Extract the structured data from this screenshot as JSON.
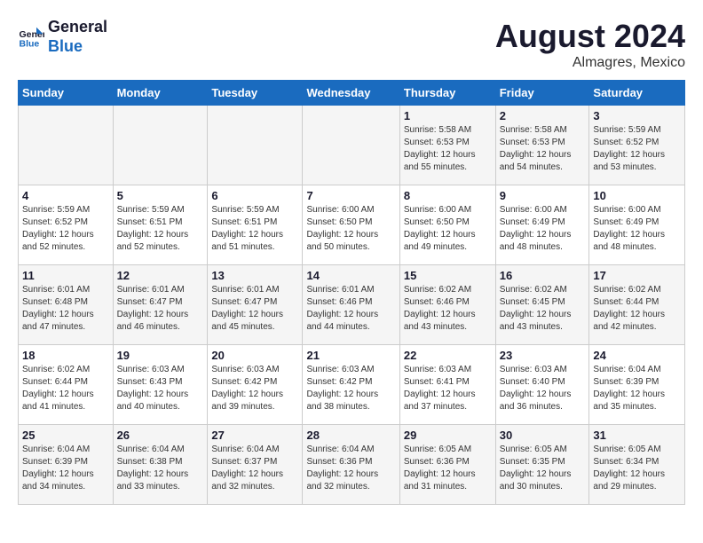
{
  "header": {
    "logo_line1": "General",
    "logo_line2": "Blue",
    "month_year": "August 2024",
    "location": "Almagres, Mexico"
  },
  "calendar": {
    "days_of_week": [
      "Sunday",
      "Monday",
      "Tuesday",
      "Wednesday",
      "Thursday",
      "Friday",
      "Saturday"
    ],
    "weeks": [
      [
        {
          "day": "",
          "detail": ""
        },
        {
          "day": "",
          "detail": ""
        },
        {
          "day": "",
          "detail": ""
        },
        {
          "day": "",
          "detail": ""
        },
        {
          "day": "1",
          "detail": "Sunrise: 5:58 AM\nSunset: 6:53 PM\nDaylight: 12 hours\nand 55 minutes."
        },
        {
          "day": "2",
          "detail": "Sunrise: 5:58 AM\nSunset: 6:53 PM\nDaylight: 12 hours\nand 54 minutes."
        },
        {
          "day": "3",
          "detail": "Sunrise: 5:59 AM\nSunset: 6:52 PM\nDaylight: 12 hours\nand 53 minutes."
        }
      ],
      [
        {
          "day": "4",
          "detail": "Sunrise: 5:59 AM\nSunset: 6:52 PM\nDaylight: 12 hours\nand 52 minutes."
        },
        {
          "day": "5",
          "detail": "Sunrise: 5:59 AM\nSunset: 6:51 PM\nDaylight: 12 hours\nand 52 minutes."
        },
        {
          "day": "6",
          "detail": "Sunrise: 5:59 AM\nSunset: 6:51 PM\nDaylight: 12 hours\nand 51 minutes."
        },
        {
          "day": "7",
          "detail": "Sunrise: 6:00 AM\nSunset: 6:50 PM\nDaylight: 12 hours\nand 50 minutes."
        },
        {
          "day": "8",
          "detail": "Sunrise: 6:00 AM\nSunset: 6:50 PM\nDaylight: 12 hours\nand 49 minutes."
        },
        {
          "day": "9",
          "detail": "Sunrise: 6:00 AM\nSunset: 6:49 PM\nDaylight: 12 hours\nand 48 minutes."
        },
        {
          "day": "10",
          "detail": "Sunrise: 6:00 AM\nSunset: 6:49 PM\nDaylight: 12 hours\nand 48 minutes."
        }
      ],
      [
        {
          "day": "11",
          "detail": "Sunrise: 6:01 AM\nSunset: 6:48 PM\nDaylight: 12 hours\nand 47 minutes."
        },
        {
          "day": "12",
          "detail": "Sunrise: 6:01 AM\nSunset: 6:47 PM\nDaylight: 12 hours\nand 46 minutes."
        },
        {
          "day": "13",
          "detail": "Sunrise: 6:01 AM\nSunset: 6:47 PM\nDaylight: 12 hours\nand 45 minutes."
        },
        {
          "day": "14",
          "detail": "Sunrise: 6:01 AM\nSunset: 6:46 PM\nDaylight: 12 hours\nand 44 minutes."
        },
        {
          "day": "15",
          "detail": "Sunrise: 6:02 AM\nSunset: 6:46 PM\nDaylight: 12 hours\nand 43 minutes."
        },
        {
          "day": "16",
          "detail": "Sunrise: 6:02 AM\nSunset: 6:45 PM\nDaylight: 12 hours\nand 43 minutes."
        },
        {
          "day": "17",
          "detail": "Sunrise: 6:02 AM\nSunset: 6:44 PM\nDaylight: 12 hours\nand 42 minutes."
        }
      ],
      [
        {
          "day": "18",
          "detail": "Sunrise: 6:02 AM\nSunset: 6:44 PM\nDaylight: 12 hours\nand 41 minutes."
        },
        {
          "day": "19",
          "detail": "Sunrise: 6:03 AM\nSunset: 6:43 PM\nDaylight: 12 hours\nand 40 minutes."
        },
        {
          "day": "20",
          "detail": "Sunrise: 6:03 AM\nSunset: 6:42 PM\nDaylight: 12 hours\nand 39 minutes."
        },
        {
          "day": "21",
          "detail": "Sunrise: 6:03 AM\nSunset: 6:42 PM\nDaylight: 12 hours\nand 38 minutes."
        },
        {
          "day": "22",
          "detail": "Sunrise: 6:03 AM\nSunset: 6:41 PM\nDaylight: 12 hours\nand 37 minutes."
        },
        {
          "day": "23",
          "detail": "Sunrise: 6:03 AM\nSunset: 6:40 PM\nDaylight: 12 hours\nand 36 minutes."
        },
        {
          "day": "24",
          "detail": "Sunrise: 6:04 AM\nSunset: 6:39 PM\nDaylight: 12 hours\nand 35 minutes."
        }
      ],
      [
        {
          "day": "25",
          "detail": "Sunrise: 6:04 AM\nSunset: 6:39 PM\nDaylight: 12 hours\nand 34 minutes."
        },
        {
          "day": "26",
          "detail": "Sunrise: 6:04 AM\nSunset: 6:38 PM\nDaylight: 12 hours\nand 33 minutes."
        },
        {
          "day": "27",
          "detail": "Sunrise: 6:04 AM\nSunset: 6:37 PM\nDaylight: 12 hours\nand 32 minutes."
        },
        {
          "day": "28",
          "detail": "Sunrise: 6:04 AM\nSunset: 6:36 PM\nDaylight: 12 hours\nand 32 minutes."
        },
        {
          "day": "29",
          "detail": "Sunrise: 6:05 AM\nSunset: 6:36 PM\nDaylight: 12 hours\nand 31 minutes."
        },
        {
          "day": "30",
          "detail": "Sunrise: 6:05 AM\nSunset: 6:35 PM\nDaylight: 12 hours\nand 30 minutes."
        },
        {
          "day": "31",
          "detail": "Sunrise: 6:05 AM\nSunset: 6:34 PM\nDaylight: 12 hours\nand 29 minutes."
        }
      ]
    ]
  }
}
